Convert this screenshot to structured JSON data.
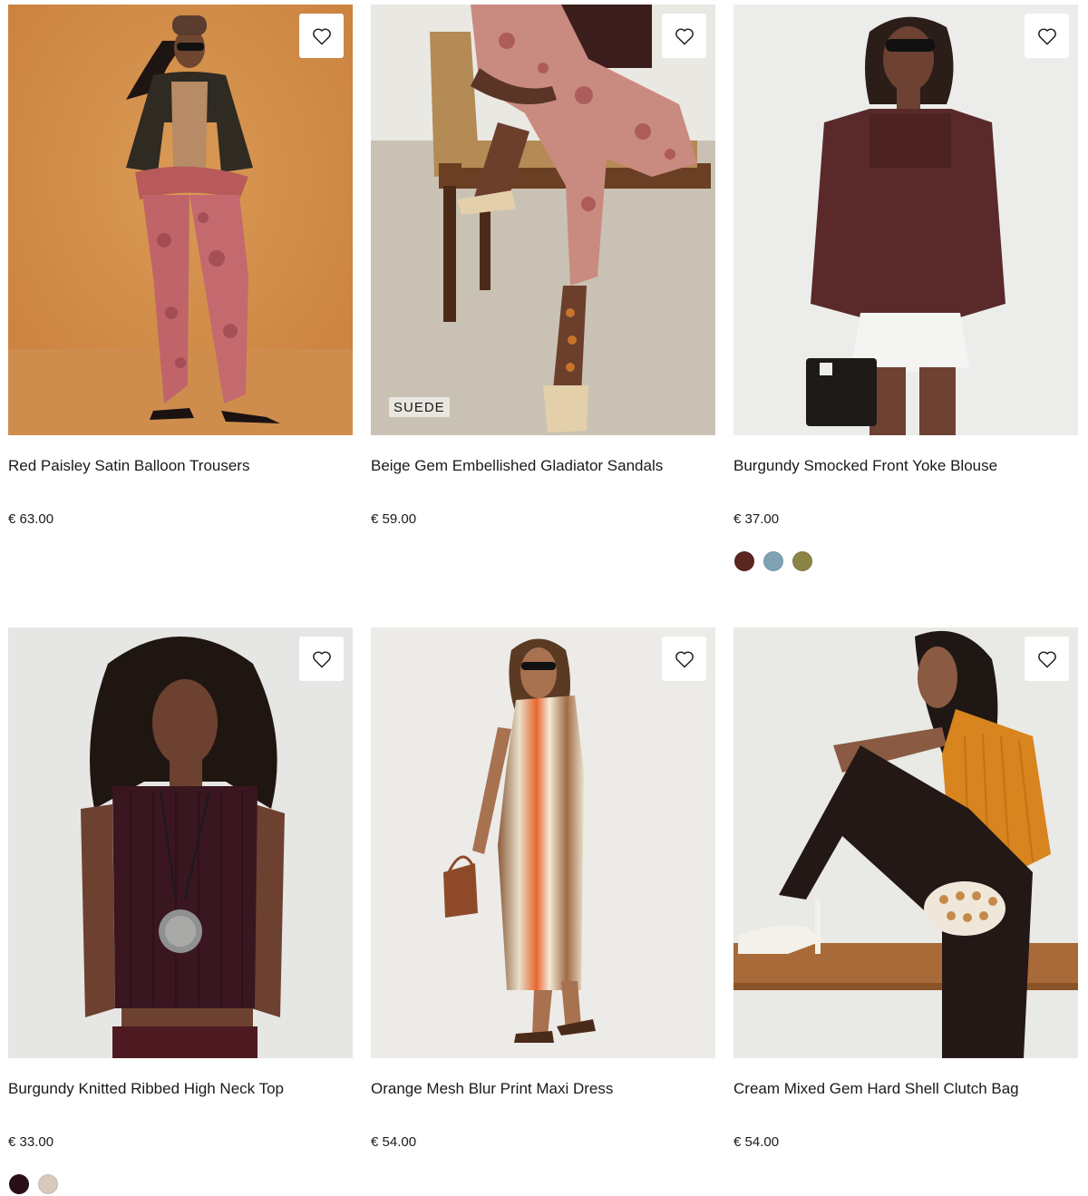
{
  "products": [
    {
      "title": "Red Paisley Satin Balloon Trousers",
      "price": "€ 63.00",
      "badge": "",
      "swatches": [],
      "image": "woman in paisley satin balloon trousers and dark jacket on orange backdrop"
    },
    {
      "title": "Beige Gem Embellished Gladiator Sandals",
      "price": "€ 59.00",
      "badge": "SUEDE",
      "swatches": [],
      "image": "seated model wearing beige gem gladiator sandals on rattan chair"
    },
    {
      "title": "Burgundy Smocked Front Yoke Blouse",
      "price": "€ 37.00",
      "badge": "",
      "swatches": [
        "#5a2620",
        "#7fa3b3",
        "#8c8445"
      ],
      "image": "model in burgundy smocked blouse and white shorts holding black bag"
    },
    {
      "title": "Burgundy Knitted Ribbed High Neck Top",
      "price": "€ 33.00",
      "badge": "",
      "swatches": [
        "#2a0f18",
        "#d8c9bd"
      ],
      "image": "model with curly hair in burgundy ribbed high neck top with pendant"
    },
    {
      "title": "Orange Mesh Blur Print Maxi Dress",
      "price": "€ 54.00",
      "badge": "",
      "swatches": [],
      "image": "model in orange and brown blur print maxi dress with beaded bag"
    },
    {
      "title": "Cream Mixed Gem Hard Shell Clutch Bag",
      "price": "€ 54.00",
      "badge": "",
      "swatches": [],
      "image": "seated model in orange fringe halter holding cream gem clutch"
    }
  ],
  "wishlist_icon": "heart-outline-icon"
}
